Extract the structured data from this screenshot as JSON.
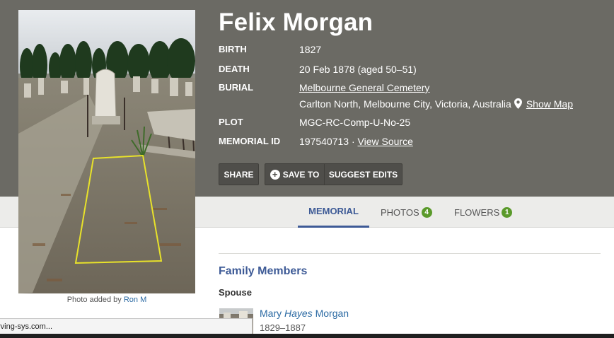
{
  "memorial": {
    "name": "Felix Morgan",
    "facts": {
      "birth_label": "BIRTH",
      "birth_value": "1827",
      "death_label": "DEATH",
      "death_value": "20 Feb 1878 (aged 50–51)",
      "burial_label": "BURIAL",
      "burial_cemetery": "Melbourne General Cemetery",
      "burial_location": "Carlton North, Melbourne City, Victoria, Australia",
      "show_map": "Show Map",
      "plot_label": "PLOT",
      "plot_value": "MGC-RC-Comp-U-No-25",
      "memorial_id_label": "MEMORIAL ID",
      "memorial_id_value": "197540713 ·",
      "view_source": "View Source"
    }
  },
  "photo": {
    "caption_prefix": "Photo added by",
    "caption_author": "Ron M"
  },
  "actions": {
    "share": "SHARE",
    "save_to": "SAVE TO",
    "suggest_edits": "SUGGEST EDITS",
    "plus_icon": "+"
  },
  "tabs": {
    "memorial": "MEMORIAL",
    "photos": "PHOTOS",
    "photos_count": "4",
    "flowers": "FLOWERS",
    "flowers_count": "1"
  },
  "family": {
    "section_title": "Family Members",
    "spouse_label": "Spouse",
    "spouse_first": "Mary",
    "spouse_middle": "Hayes",
    "spouse_last": "Morgan",
    "spouse_dates": "1829–1887"
  },
  "status_bar": {
    "text": "rving-sys.com..."
  },
  "colors": {
    "header_bg": "#6b6a64",
    "accent_blue": "#3d5a96",
    "link_blue": "#2b6aa3",
    "badge_green": "#5a9a2a"
  },
  "icons": [
    "map-pin-icon",
    "plus-circle-icon"
  ]
}
